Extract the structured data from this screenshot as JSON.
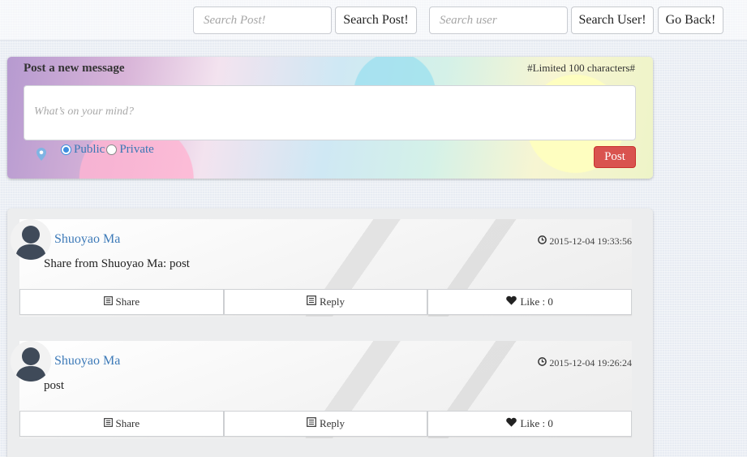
{
  "header": {
    "search_post_placeholder": "Search Post!",
    "search_post_button": "Search Post!",
    "search_user_placeholder": "Search user",
    "search_user_button": "Search User!",
    "go_back_button": "Go Back!"
  },
  "new_post": {
    "title": "Post a new message",
    "limit_note": "#Limited 100 characters#",
    "placeholder": "What’s on your mind?",
    "visibility_options": [
      "Public",
      "Private"
    ],
    "selected_visibility": "Public",
    "post_button": "Post",
    "location_icon": "map-marker-icon"
  },
  "posts": [
    {
      "author": "Shuoyao Ma",
      "timestamp": "2015-12-04 19:33:56",
      "text": "Share from Shuoyao Ma: post",
      "share_label": "Share",
      "reply_label": "Reply",
      "like_label": "Like : 0"
    },
    {
      "author": "Shuoyao Ma",
      "timestamp": "2015-12-04 19:26:24",
      "text": "post",
      "share_label": "Share",
      "reply_label": "Reply",
      "like_label": "Like : 0"
    }
  ],
  "colors": {
    "post_button": "#d9534f",
    "link_blue": "#3d7ab8",
    "radio_blue": "#3d8ede"
  }
}
